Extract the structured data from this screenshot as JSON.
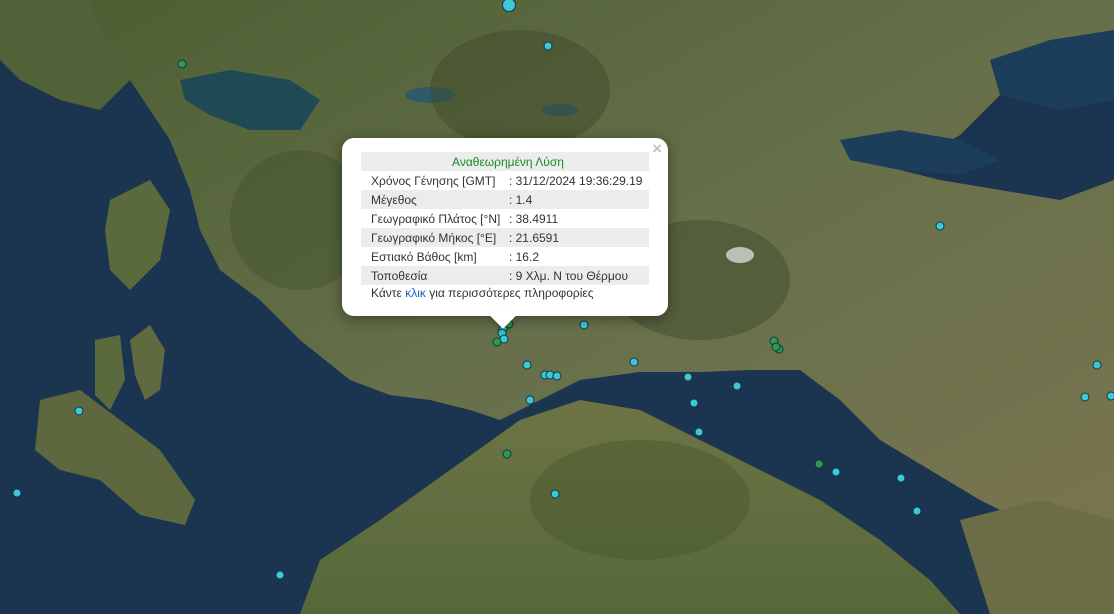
{
  "popup": {
    "header": "Αναθεωρημένη Λύση",
    "close_symbol": "×",
    "rows": [
      {
        "label": "Χρόνος Γένησης [GMT]",
        "value": ": 31/12/2024 19:36:29.19"
      },
      {
        "label": "Μέγεθος",
        "value": ": 1.4"
      },
      {
        "label": "Γεωγραφικό Πλάτος [°N]",
        "value": ": 38.4911"
      },
      {
        "label": "Γεωγραφικό Μήκος [°E]",
        "value": ": 21.6591"
      },
      {
        "label": "Εστιακό Βάθος [km]",
        "value": ": 16.2"
      },
      {
        "label": "Τοποθεσία",
        "value": ": 9 Χλμ. Ν του Θέρμου"
      }
    ],
    "more_prefix": "Κάντε ",
    "more_link": "κλικ",
    "more_suffix": " για περισσότερες πληροφορίες"
  },
  "colors": {
    "quake_recent": "#3cc8d8",
    "quake_older": "#2e9a4a",
    "sea": "#1b3550",
    "land": "#5b6b3d",
    "popup_header_text": "#1a8a1a",
    "link": "#1f5fbf"
  }
}
